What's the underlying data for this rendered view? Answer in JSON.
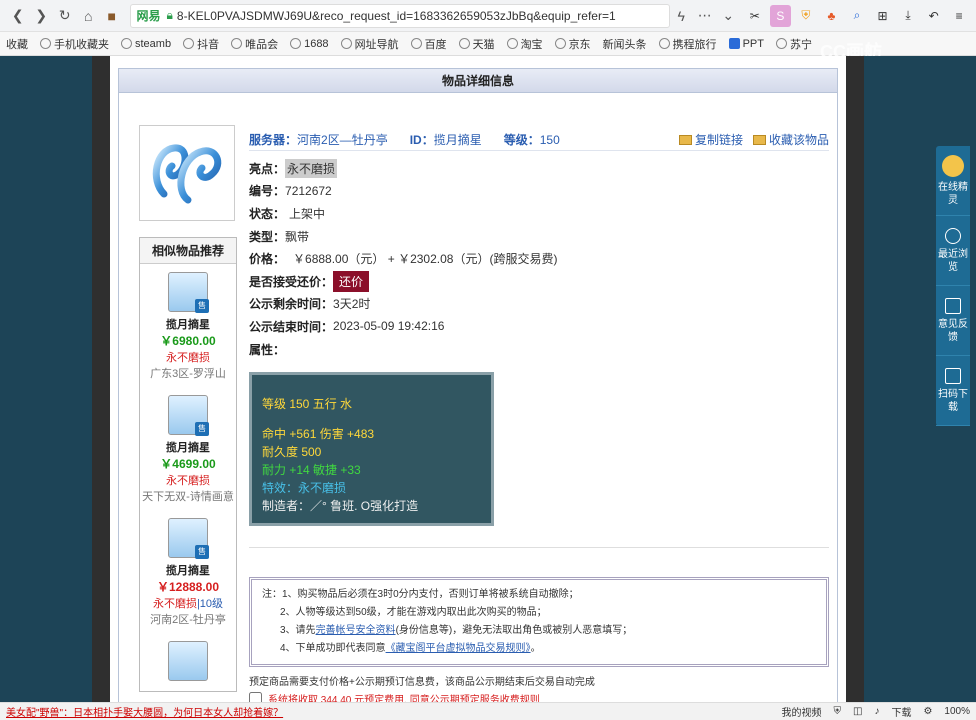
{
  "browser": {
    "site_label": "网易",
    "url": "8-KEL0PVAJSDMWJ69U&reco_request_id=1683362659053zJbBq&equip_refer=1",
    "bookmarks": [
      "收藏",
      "手机收藏夹",
      "steamb",
      "抖音",
      "唯品会",
      "1688",
      "网址导航",
      "百度",
      "天猫",
      "淘宝",
      "京东",
      "新闻头条",
      "携程旅行",
      "PPT",
      "苏宁",
      "...",
      "...",
      "..."
    ],
    "watermark": "CC画舫"
  },
  "panel": {
    "title": "物品详细信息"
  },
  "item": {
    "server_label": "服务器：",
    "server": "河南2区—牡丹亭",
    "id_label": "ID：",
    "id": "揽月摘星",
    "level_label": "等级：",
    "level": "150",
    "copy_link": "复制链接",
    "favorite": "收藏该物品",
    "highlight_label": "亮点：",
    "highlight": "永不磨损",
    "number_label": "编号：",
    "number": "7212672",
    "status_label": "状态：",
    "status": "上架中",
    "type_label": "类型：",
    "type": "飘带",
    "price_label": "价格：",
    "price": "￥6888.00（元） +  ￥2302.08（元）(跨服交易费)",
    "bargain_label": "是否接受还价：",
    "bargain_button": "还价",
    "remaining_label": "公示剩余时间：",
    "remaining": "3天2时",
    "end_label": "公示结束时间：",
    "end_time": "2023-05-09 19:42:16",
    "attr_label": "属性："
  },
  "stats": {
    "line1": "等级 150 五行 水",
    "line2": "命中 +561 伤害 +483",
    "line3": "耐久度 500",
    "line4": "耐力 +14 敏捷 +33",
    "line5": "特效：永不磨损",
    "line6": "制造者：／° 鲁班. O强化打造"
  },
  "similar": {
    "title": "相似物品推荐",
    "sale_badge": "售",
    "items": [
      {
        "name": "揽月摘星",
        "price": "￥6980.00",
        "attr": "永不磨损",
        "level": "",
        "server": "广东3区-罗浮山"
      },
      {
        "name": "揽月摘星",
        "price": "￥4699.00",
        "attr": "永不磨损",
        "level": "",
        "server": "天下无双-诗情画意"
      },
      {
        "name": "揽月摘星",
        "price": "￥12888.00",
        "attr": "永不磨损",
        "level": "|10级",
        "server": "河南2区-牡丹亭"
      }
    ]
  },
  "notes": {
    "line1": "注：1、购买物品后必须在3时0分内支付，否则订单将被系统自动撤除；",
    "line2": "2、人物等级达到50级，才能在游戏内取出此次购买的物品；",
    "line3a": "3、请先",
    "line3link": "完善帐号安全资料",
    "line3b": "(身份信息等)，避免无法取出角色或被别人恶意填写；",
    "line4a": "4、下单成功即代表同意",
    "line4link": "《藏宝阁平台虚拟物品交易规则》",
    "line4b": "。"
  },
  "bottom": {
    "note": "预定商品需要支付价格+公示期预订信息费，该商品公示期结束后交易自动完成",
    "fee_text": "系统将收取 344.40 元预定费用, 同意公示期预定服务收费规则"
  },
  "side": {
    "online": "在线精灵",
    "recent": "最近浏览",
    "feedback": "意见反馈",
    "scan": "扫码下载"
  },
  "statusbar": {
    "news": "美女配\"野兽\"：日本相扑手娶大腰圆，为何日本女人却抢着嫁？",
    "video": "我的视频",
    "download": "下载",
    "zoom": "100%"
  }
}
